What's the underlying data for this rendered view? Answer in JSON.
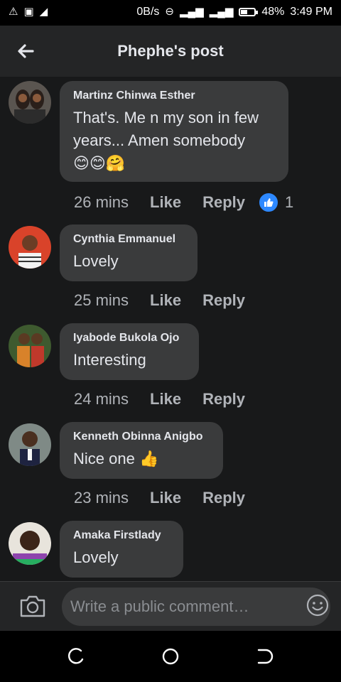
{
  "status_bar": {
    "speed": "0B/s",
    "battery_percent": "48%",
    "battery_level": 0.48,
    "time": "3:49 PM"
  },
  "header": {
    "title": "Phephe's post"
  },
  "comments": [
    {
      "author": "Martinz Chinwa Esther",
      "text": "That's. Me n my son in few years... Amen somebody",
      "emojis": "😊😊🤗",
      "time": "26 mins",
      "like": "Like",
      "reply": "Reply",
      "reaction_count": "1"
    },
    {
      "author": "Cynthia Emmanuel",
      "text": "Lovely",
      "time": "25 mins",
      "like": "Like",
      "reply": "Reply"
    },
    {
      "author": "Iyabode Bukola Ojo",
      "text": "Interesting",
      "time": "24 mins",
      "like": "Like",
      "reply": "Reply"
    },
    {
      "author": "Kenneth Obinna Anigbo",
      "text": "Nice one 👍",
      "time": "23 mins",
      "like": "Like",
      "reply": "Reply"
    },
    {
      "author": "Amaka Firstlady",
      "text": "Lovely"
    }
  ],
  "composer": {
    "placeholder": "Write a public comment…"
  },
  "colors": {
    "background": "#18191a",
    "bubble": "#3a3b3c",
    "accent": "#2d88ff"
  }
}
